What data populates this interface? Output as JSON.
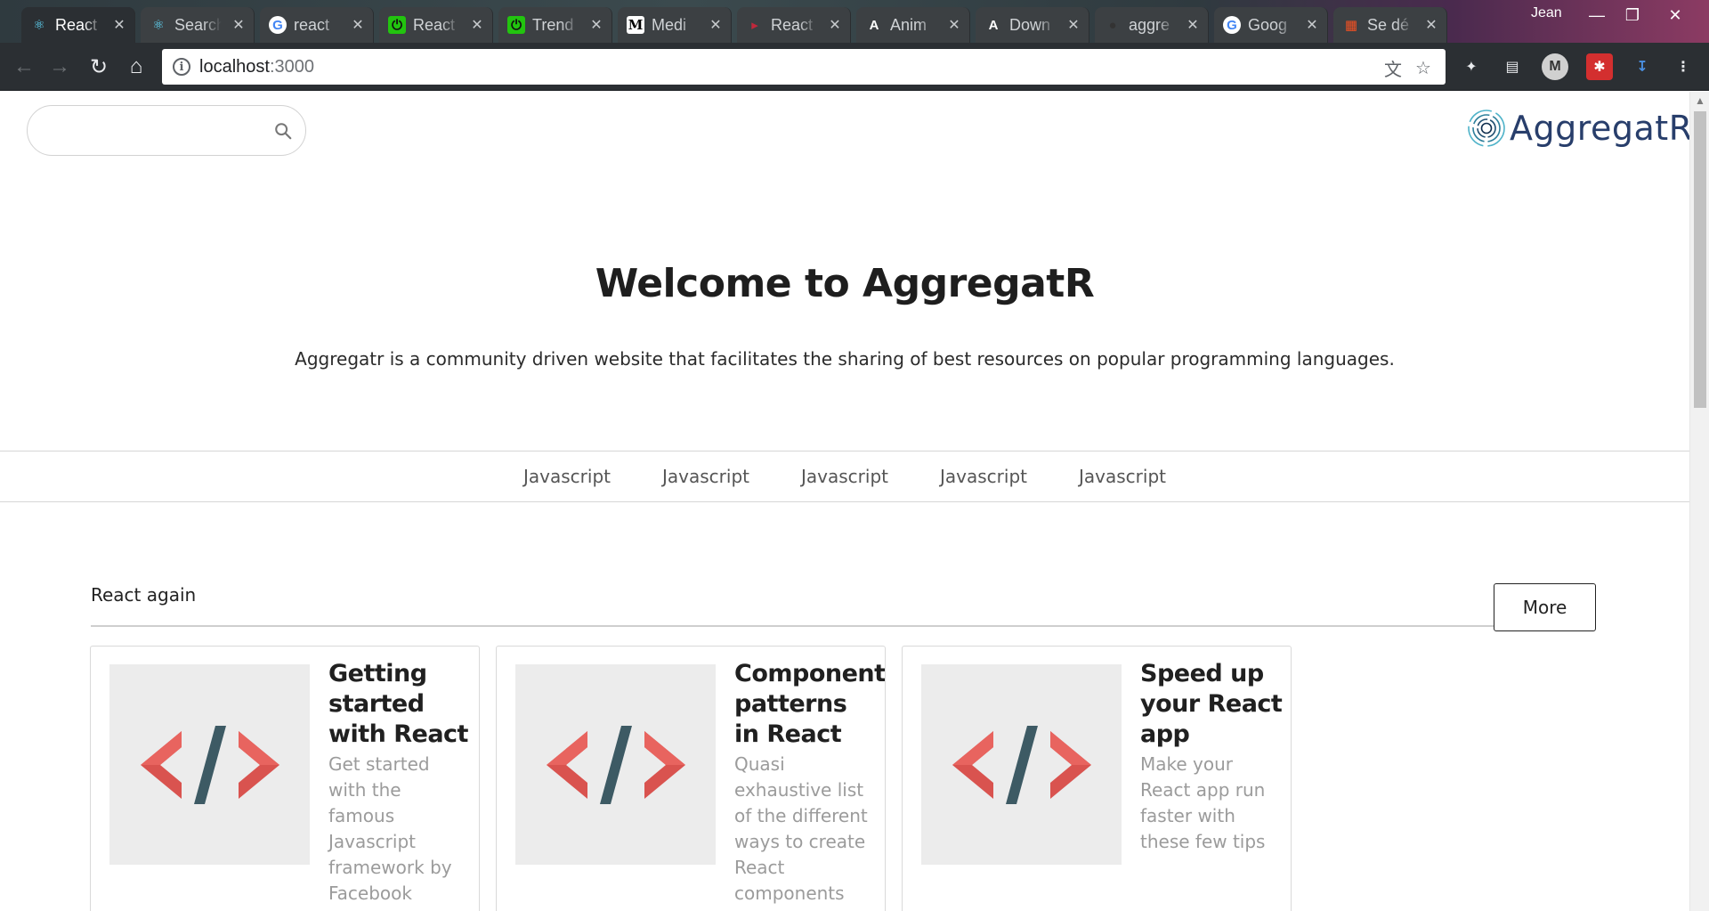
{
  "browser": {
    "tabs": [
      {
        "title": "React",
        "favicon": "react-icon",
        "color": "#61dafb",
        "active": true
      },
      {
        "title": "Search",
        "favicon": "react-icon",
        "color": "#61dafb"
      },
      {
        "title": "react",
        "favicon": "google-icon",
        "color": "#4285f4"
      },
      {
        "title": "React",
        "favicon": "green-logo-icon",
        "color": "#22c40f"
      },
      {
        "title": "Trend",
        "favicon": "green-logo-icon",
        "color": "#22c40f"
      },
      {
        "title": "Medi",
        "favicon": "medium-icon",
        "color": "#000000"
      },
      {
        "title": "React",
        "favicon": "react-arrow-icon",
        "color": "#c0283b"
      },
      {
        "title": "Anim",
        "favicon": "a-icon",
        "color": "#ffffff"
      },
      {
        "title": "Down",
        "favicon": "a-icon",
        "color": "#ffffff"
      },
      {
        "title": "aggre",
        "favicon": "github-icon",
        "color": "#333333"
      },
      {
        "title": "Goog",
        "favicon": "google-icon",
        "color": "#4285f4"
      },
      {
        "title": "Se dé",
        "favicon": "microsoft-icon",
        "color": "#f25022"
      }
    ],
    "user": "Jean",
    "url_host": "localhost",
    "url_port": ":3000"
  },
  "header": {
    "search_placeholder": "",
    "brand": "AggregatR"
  },
  "hero": {
    "title": "Welcome to AggregatR",
    "subtitle": "Aggregatr is a community driven website that facilitates the sharing of best resources on popular programming languages."
  },
  "categories": [
    "Javascript",
    "Javascript",
    "Javascript",
    "Javascript",
    "Javascript"
  ],
  "section": {
    "title": "React again",
    "more_label": "More"
  },
  "cards": [
    {
      "title": "Getting started with React",
      "description": "Get started with the famous Javascript framework by Facebook"
    },
    {
      "title": "Component patterns in React",
      "description": "Quasi exhaustive list of the different ways to create React components"
    },
    {
      "title": "Speed up your React app",
      "description": "Make your React app run faster with these few tips"
    }
  ],
  "colors": {
    "brand": "#283e6b",
    "code_bracket": "#d9534f",
    "code_slash": "#3d5a64"
  }
}
